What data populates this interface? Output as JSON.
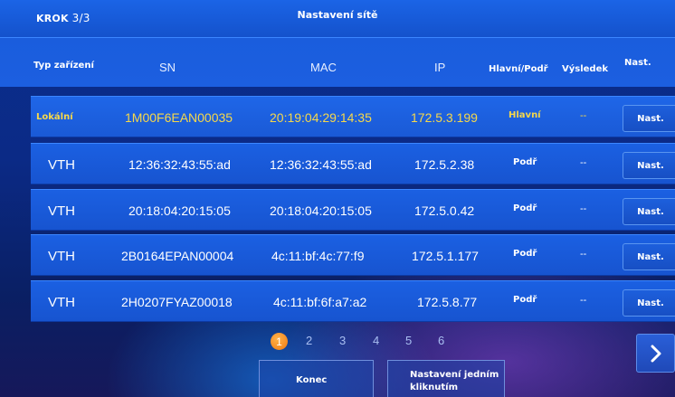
{
  "header": {
    "step_label": "KROK",
    "step_value": "3/3",
    "title": "Nastavení sítě"
  },
  "columns": {
    "type": "Typ zařízení",
    "sn": "SN",
    "mac": "MAC",
    "ip": "IP",
    "role": "Hlavní/Podř",
    "result": "Výsledek",
    "set": "Nast."
  },
  "rows": [
    {
      "type": "Lokální",
      "sn": "1M00F6EAN00035",
      "mac": "20:19:04:29:14:35",
      "ip": "172.5.3.199",
      "role": "Hlavní",
      "result": "--",
      "button": "Nast."
    },
    {
      "type": "VTH",
      "sn": "12:36:32:43:55:ad",
      "mac": "12:36:32:43:55:ad",
      "ip": "172.5.2.38",
      "role": "Podř",
      "result": "--",
      "button": "Nast."
    },
    {
      "type": "VTH",
      "sn": "20:18:04:20:15:05",
      "mac": "20:18:04:20:15:05",
      "ip": "172.5.0.42",
      "role": "Podř",
      "result": "--",
      "button": "Nast."
    },
    {
      "type": "VTH",
      "sn": "2B0164EPAN00004",
      "mac": "4c:11:bf:4c:77:f9",
      "ip": "172.5.1.177",
      "role": "Podř",
      "result": "--",
      "button": "Nast."
    },
    {
      "type": "VTH",
      "sn": "2H0207FYAZ00018",
      "mac": "4c:11:bf:6f:a7:a2",
      "ip": "172.5.8.77",
      "role": "Podř",
      "result": "--",
      "button": "Nast."
    }
  ],
  "pagination": {
    "pages": [
      "1",
      "2",
      "3",
      "4",
      "5",
      "6"
    ],
    "current": "1"
  },
  "footer": {
    "finish": "Konec",
    "oneclick": "Nastavení jedním kliknutím"
  },
  "icons": {
    "next": "chevron-right-icon"
  },
  "colors": {
    "accent": "#f6d84a",
    "active_page": "#f08a1c",
    "row": "#1b5ddc"
  }
}
